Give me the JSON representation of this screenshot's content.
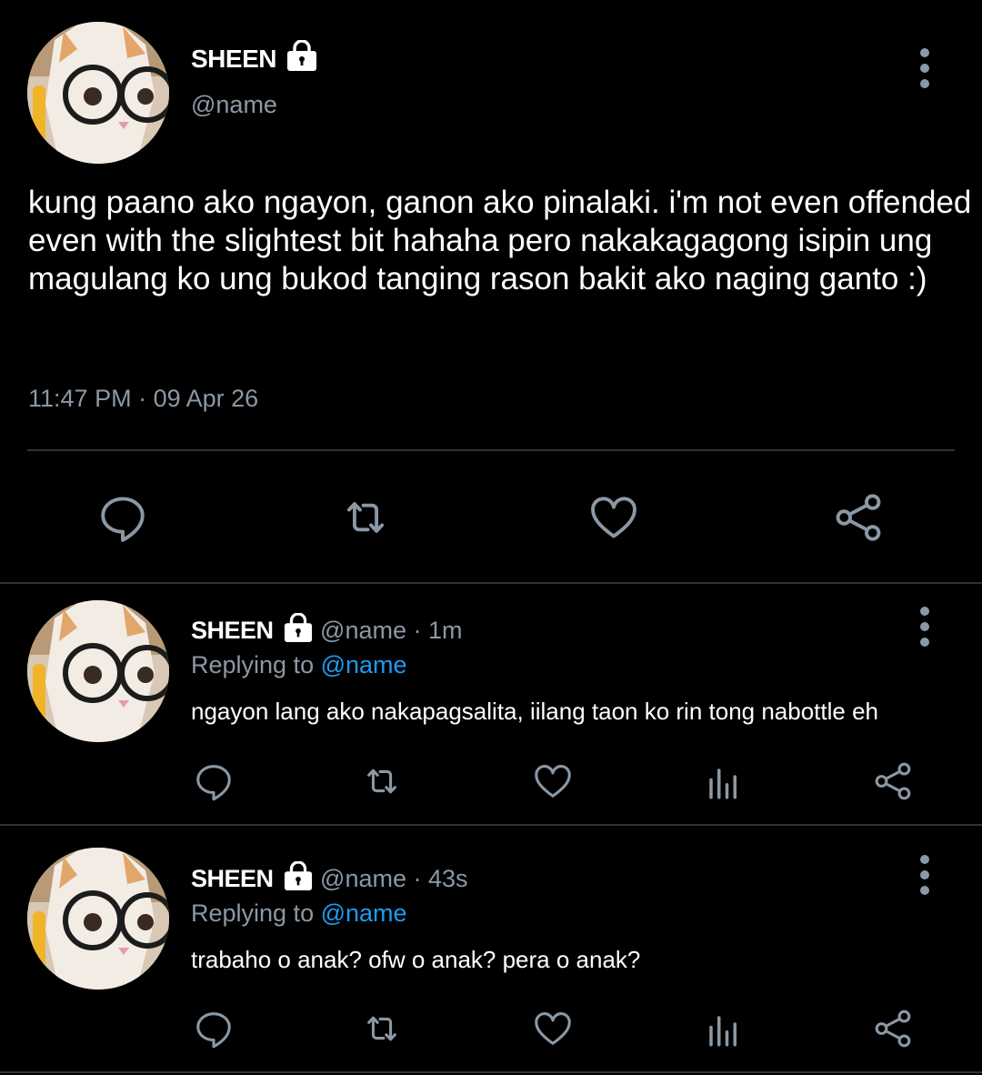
{
  "main_tweet": {
    "author_name": "SHEEN",
    "handle": "@name",
    "text": "kung paano ako ngayon, ganon ako pinalaki. i'm not even offended even with the slightest bit hahaha pero nakakagagong isipin ung magulang ko ung bukod tanging rason bakit ako naging ganto :)",
    "time": "11:47 PM",
    "date": "09 Apr 26",
    "actions": [
      "reply-icon",
      "retweet-icon",
      "like-icon",
      "share-icon"
    ]
  },
  "replies": [
    {
      "author_name": "SHEEN",
      "handle": "@name",
      "age": "1m",
      "replying_label": "Replying to",
      "replying_to": "@name",
      "text": "ngayon lang ako nakapagsalita, iilang taon ko rin tong nabottle eh",
      "actions": [
        "reply-icon",
        "retweet-icon",
        "like-icon",
        "analytics-icon",
        "share-icon"
      ]
    },
    {
      "author_name": "SHEEN",
      "handle": "@name",
      "age": "43s",
      "replying_label": "Replying to",
      "replying_to": "@name",
      "text": "trabaho o anak? ofw o anak? pera o anak?",
      "actions": [
        "reply-icon",
        "retweet-icon",
        "like-icon",
        "analytics-icon",
        "share-icon"
      ]
    }
  ],
  "separator": " · ",
  "colors": {
    "background": "#000000",
    "text": "#ffffff",
    "secondary": "#8b98a5",
    "mention": "#1d9bf0",
    "divider": "#2f3336",
    "icon": "#8b98a5"
  }
}
